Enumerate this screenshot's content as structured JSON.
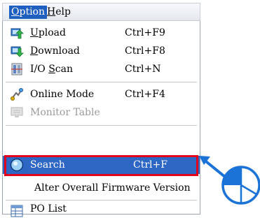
{
  "menubar": {
    "option": "Option",
    "option_key": "O",
    "option_rest": "ption",
    "help": "Help",
    "help_key": "H",
    "help_rest": "elp"
  },
  "menu": {
    "upload": {
      "label": "Upload",
      "key": "U",
      "rest": "pload",
      "shortcut": "Ctrl+F9"
    },
    "download": {
      "label": "Download",
      "key": "D",
      "rest": "ownload",
      "shortcut": "Ctrl+F8"
    },
    "ioscan": {
      "pre": "I/O ",
      "key": "S",
      "rest": "can",
      "shortcut": "Ctrl+N"
    },
    "online": {
      "label": "Online Mode",
      "shortcut": "Ctrl+F4"
    },
    "monitor": {
      "label": "Monitor Table"
    },
    "search": {
      "label": "Search",
      "shortcut": "Ctrl+F"
    },
    "alter": {
      "label": "Alter Overall Firmware Version"
    },
    "polist": {
      "label": "PO List"
    }
  },
  "colors": {
    "accent": "#2e66c3",
    "highlight_border": "#e0001b",
    "pointer": "#1b73d8"
  }
}
